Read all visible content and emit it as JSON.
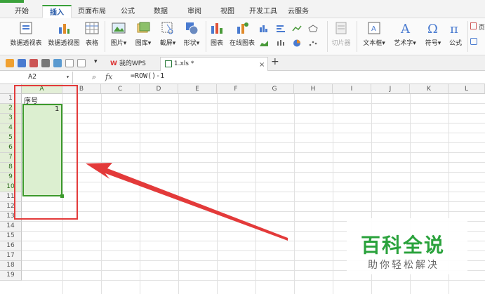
{
  "menu": {
    "tabs": [
      "开始",
      "插入",
      "页面布局",
      "公式",
      "数据",
      "审阅",
      "视图",
      "开发工具",
      "云服务"
    ],
    "active_index": 1
  },
  "ribbon": {
    "pivot_table": "数据透视表",
    "pivot_chart": "数据透视图",
    "table": "表格",
    "picture": "图片",
    "gallery": "图库",
    "screenshot": "截屏",
    "shape": "形状",
    "chart": "图表",
    "online_chart": "在线图表",
    "slicer": "切片器",
    "textbox": "文本框",
    "art_text": "艺术字",
    "symbol": "符号",
    "formula": "公式",
    "truncated_right": "页"
  },
  "doc_tabs": {
    "home_tab": "我的WPS",
    "file_tab": "1.xls *",
    "add": "+",
    "close": "×"
  },
  "formula_bar": {
    "name_box": "A2",
    "fx": "fx",
    "formula": "=ROW()-1"
  },
  "columns": [
    "A",
    "B",
    "C",
    "D",
    "E",
    "F",
    "G",
    "H",
    "I",
    "J",
    "K",
    "L"
  ],
  "rows": [
    "1",
    "2",
    "3",
    "4",
    "5",
    "6",
    "7",
    "8",
    "9",
    "10",
    "11",
    "12",
    "13",
    "14",
    "15",
    "16",
    "17",
    "18",
    "19"
  ],
  "cells": {
    "A1": "序号",
    "A2": "1"
  },
  "watermark": {
    "title": "百科全说",
    "subtitle": "助你轻松解决"
  },
  "colors": {
    "selection_fill": "#dcefd0",
    "selection_border": "#3c9a2c",
    "annotation_red": "#e33a3a",
    "watermark_green": "#2aa23c"
  }
}
